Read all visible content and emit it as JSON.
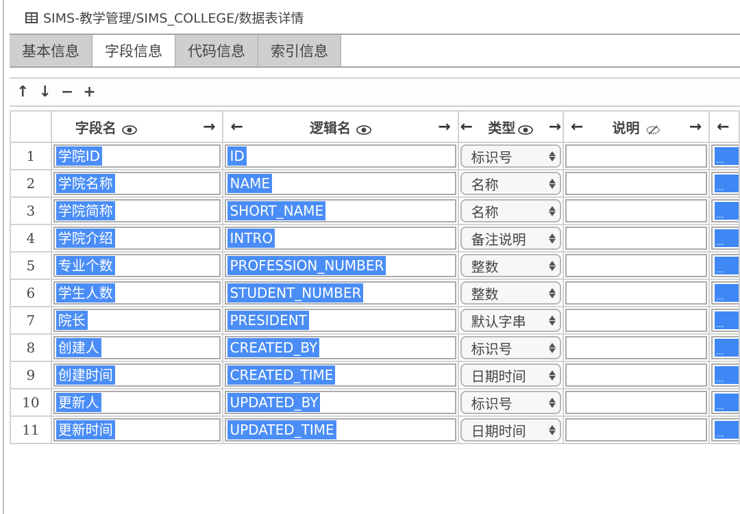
{
  "title": "SIMS-教学管理/SIMS_COLLEGE/数据表详情",
  "tabs": [
    {
      "label": "基本信息",
      "active": false
    },
    {
      "label": "字段信息",
      "active": true
    },
    {
      "label": "代码信息",
      "active": false
    },
    {
      "label": "索引信息",
      "active": false
    }
  ],
  "toolbar": {
    "move_up": "↑",
    "move_down": "↓",
    "remove": "−",
    "add": "+"
  },
  "columns": {
    "field_name": {
      "label": "字段名",
      "left": "",
      "right": "→",
      "visibility": "eye-icon"
    },
    "logical_name": {
      "label": "逻辑名",
      "left": "←",
      "right": "→",
      "visibility": "eye-icon"
    },
    "type": {
      "label": "类型",
      "left": "←",
      "right": "→",
      "visibility": "eye-icon"
    },
    "description": {
      "label": "说明",
      "left": "←",
      "right": "→",
      "visibility": "eye-slash-icon"
    },
    "next_arrow": "←"
  },
  "dots_label": "...",
  "rows": [
    {
      "no": "1",
      "field": "学院ID",
      "logical": "ID",
      "type": "标识号",
      "desc": ""
    },
    {
      "no": "2",
      "field": "学院名称",
      "logical": "NAME",
      "type": "名称",
      "desc": ""
    },
    {
      "no": "3",
      "field": "学院简称",
      "logical": "SHORT_NAME",
      "type": "名称",
      "desc": ""
    },
    {
      "no": "4",
      "field": "学院介绍",
      "logical": "INTRO",
      "type": "备注说明",
      "desc": ""
    },
    {
      "no": "5",
      "field": "专业个数",
      "logical": "PROFESSION_NUMBER",
      "type": "整数",
      "desc": ""
    },
    {
      "no": "6",
      "field": "学生人数",
      "logical": "STUDENT_NUMBER",
      "type": "整数",
      "desc": ""
    },
    {
      "no": "7",
      "field": "院长",
      "logical": "PRESIDENT",
      "type": "默认字串",
      "desc": ""
    },
    {
      "no": "8",
      "field": "创建人",
      "logical": "CREATED_BY",
      "type": "标识号",
      "desc": ""
    },
    {
      "no": "9",
      "field": "创建时间",
      "logical": "CREATED_TIME",
      "type": "日期时间",
      "desc": ""
    },
    {
      "no": "10",
      "field": "更新人",
      "logical": "UPDATED_BY",
      "type": "标识号",
      "desc": ""
    },
    {
      "no": "11",
      "field": "更新时间",
      "logical": "UPDATED_TIME",
      "type": "日期时间",
      "desc": ""
    }
  ],
  "colors": {
    "selection": "#4a8df6",
    "tab_inactive": "#cfcfcf",
    "grid_border": "#d2d2d2"
  }
}
